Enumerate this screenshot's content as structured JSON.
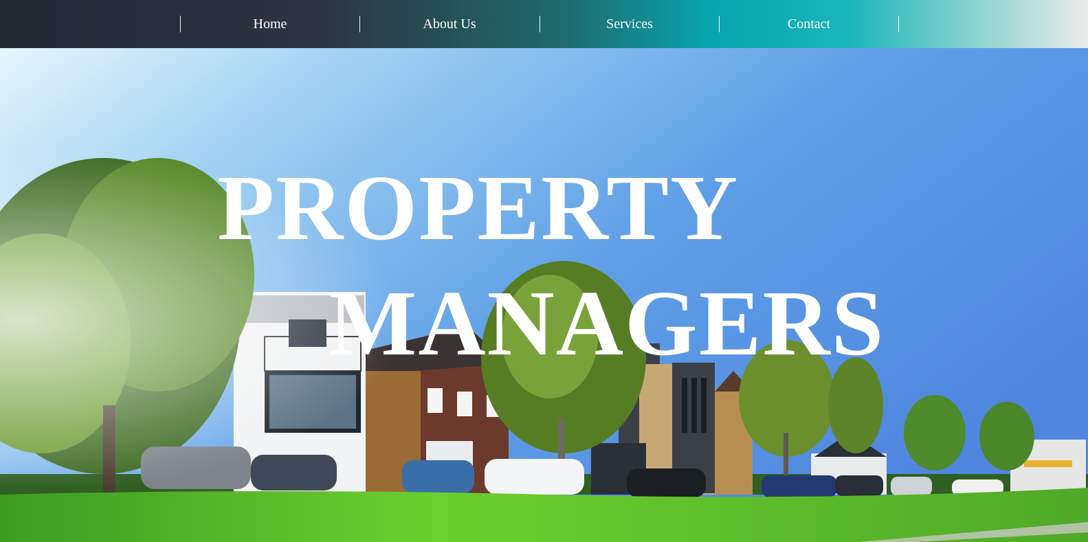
{
  "nav": {
    "items": [
      {
        "label": "Home"
      },
      {
        "label": "About Us"
      },
      {
        "label": "Services"
      },
      {
        "label": "Contact"
      }
    ]
  },
  "hero": {
    "headline_line1": "PROPERTY",
    "headline_line2": "MANAGERS",
    "image_subject": "suburban houses with parked cars, trees and lawn under blue sky"
  },
  "colors": {
    "nav_gradient_start": "#232833",
    "nav_gradient_mid": "#08a3ad",
    "nav_gradient_end": "#e9ecea",
    "sky": "#5b93e0",
    "grass": "#5fbf2e",
    "headline": "#ffffff"
  }
}
